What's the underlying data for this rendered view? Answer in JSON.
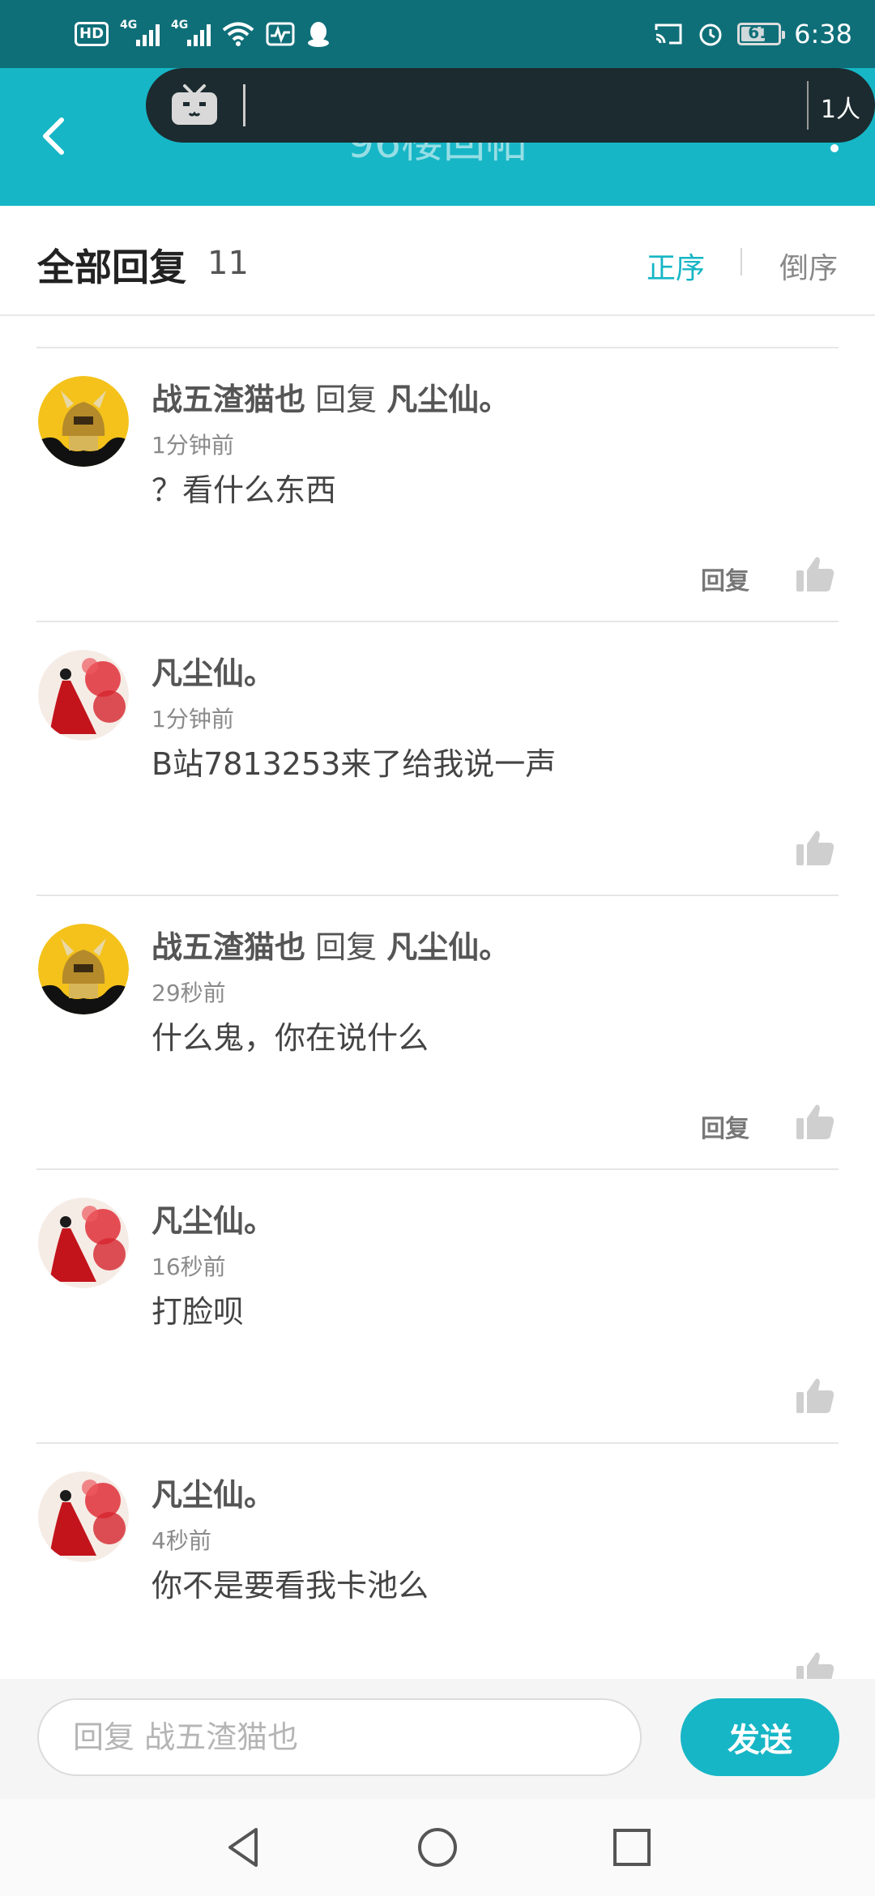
{
  "status_bar": {
    "hd": "HD",
    "net1": "4G",
    "net2": "4G",
    "battery": "61",
    "time": "6:38"
  },
  "header": {
    "title": "96楼回帖"
  },
  "live_pill": {
    "count": "1人"
  },
  "replies": {
    "title": "全部回复",
    "count": "11",
    "sort_asc": "正序",
    "sort_desc": "倒序"
  },
  "comments": [
    {
      "user": "战五渣猫也",
      "reply_word": "回复",
      "target": "凡尘仙。",
      "time": "1分钟前",
      "text": "？看什么东西",
      "reply_label": "回复",
      "avatar": "golden-knight"
    },
    {
      "user": "凡尘仙。",
      "reply_word": "",
      "target": "",
      "time": "1分钟前",
      "text": "B站7813253来了给我说一声",
      "reply_label": "",
      "avatar": "red-dress"
    },
    {
      "user": "战五渣猫也",
      "reply_word": "回复",
      "target": "凡尘仙。",
      "time": "29秒前",
      "text": "什么鬼，你在说什么",
      "reply_label": "回复",
      "avatar": "golden-knight"
    },
    {
      "user": "凡尘仙。",
      "reply_word": "",
      "target": "",
      "time": "16秒前",
      "text": "打脸呗",
      "reply_label": "",
      "avatar": "red-dress"
    },
    {
      "user": "凡尘仙。",
      "reply_word": "",
      "target": "",
      "time": "4秒前",
      "text": "你不是要看我卡池么",
      "reply_label": "",
      "avatar": "red-dress"
    }
  ],
  "input": {
    "placeholder": "回复 战五渣猫也",
    "send_label": "发送"
  },
  "colors": {
    "accent": "#16b6c6",
    "status_bar": "#0f6f79"
  }
}
